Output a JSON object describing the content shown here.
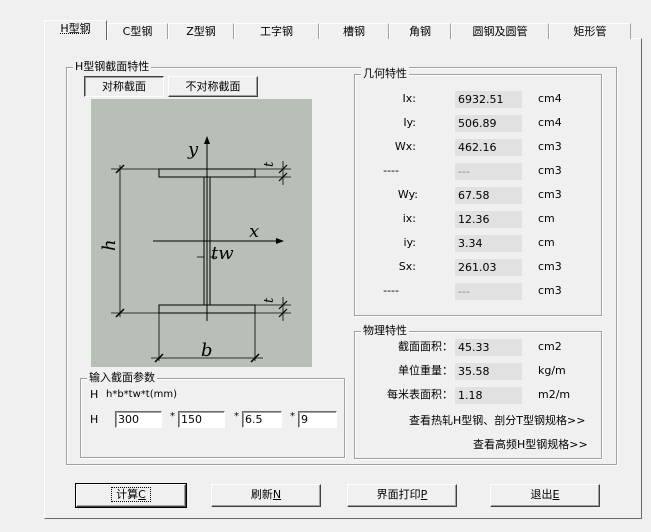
{
  "tabs": [
    {
      "label": "H型钢",
      "active": true
    },
    {
      "label": "C型钢",
      "active": false
    },
    {
      "label": "Z型钢",
      "active": false
    },
    {
      "label": "工字钢",
      "active": false
    },
    {
      "label": "槽钢",
      "active": false
    },
    {
      "label": "角钢",
      "active": false
    },
    {
      "label": "圆钢及圆管",
      "active": false
    },
    {
      "label": "矩形管",
      "active": false
    }
  ],
  "section_group": {
    "title": "H型钢截面特性",
    "symmetric_button": "对称截面",
    "asymmetric_button": "不对称截面",
    "selected": "对称截面"
  },
  "diagram": {
    "y_axis": "y",
    "x_axis": "x",
    "height_label": "h",
    "width_label": "b",
    "web_label": "tw",
    "flange_top_label": "t",
    "flange_bottom_label": "t"
  },
  "geometry": {
    "title": "几何特性",
    "rows": [
      {
        "label": "Ix:",
        "value": "6932.51",
        "unit": "cm4"
      },
      {
        "label": "Iy:",
        "value": "506.89",
        "unit": "cm4"
      },
      {
        "label": "Wx:",
        "value": "462.16",
        "unit": "cm3"
      },
      {
        "label": "----",
        "value": "---",
        "unit": "cm3"
      },
      {
        "label": "Wy:",
        "value": "67.58",
        "unit": "cm3"
      },
      {
        "label": "ix:",
        "value": "12.36",
        "unit": "cm"
      },
      {
        "label": "iy:",
        "value": "3.34",
        "unit": "cm"
      },
      {
        "label": "Sx:",
        "value": "261.03",
        "unit": "cm3"
      },
      {
        "label": "----",
        "value": "---",
        "unit": "cm3"
      }
    ]
  },
  "physical": {
    "title": "物理特性",
    "rows": [
      {
        "label": "截面面积：",
        "value": "45.33",
        "unit": "cm2"
      },
      {
        "label": "单位重量：",
        "value": "35.58",
        "unit": "kg/m"
      },
      {
        "label": "每米表面积：",
        "value": "1.18",
        "unit": "m2/m"
      }
    ],
    "link_hot_rolled": "查看热轧H型钢、剖分T型钢规格>>",
    "link_high_freq": "查看高频H型钢规格>>"
  },
  "input_group": {
    "title": "输入截面参数",
    "format_prefix": "H",
    "format_text": "h*b*tw*t(mm)",
    "row_prefix": "H",
    "separator": "*",
    "h": "300",
    "b": "150",
    "tw": "6.5",
    "t": "9"
  },
  "buttons": {
    "calc": "计算",
    "calc_key": "C",
    "refresh": "刷新",
    "refresh_key": "N",
    "print": "界面打印",
    "print_key": "P",
    "exit": "退出",
    "exit_key": "E"
  }
}
